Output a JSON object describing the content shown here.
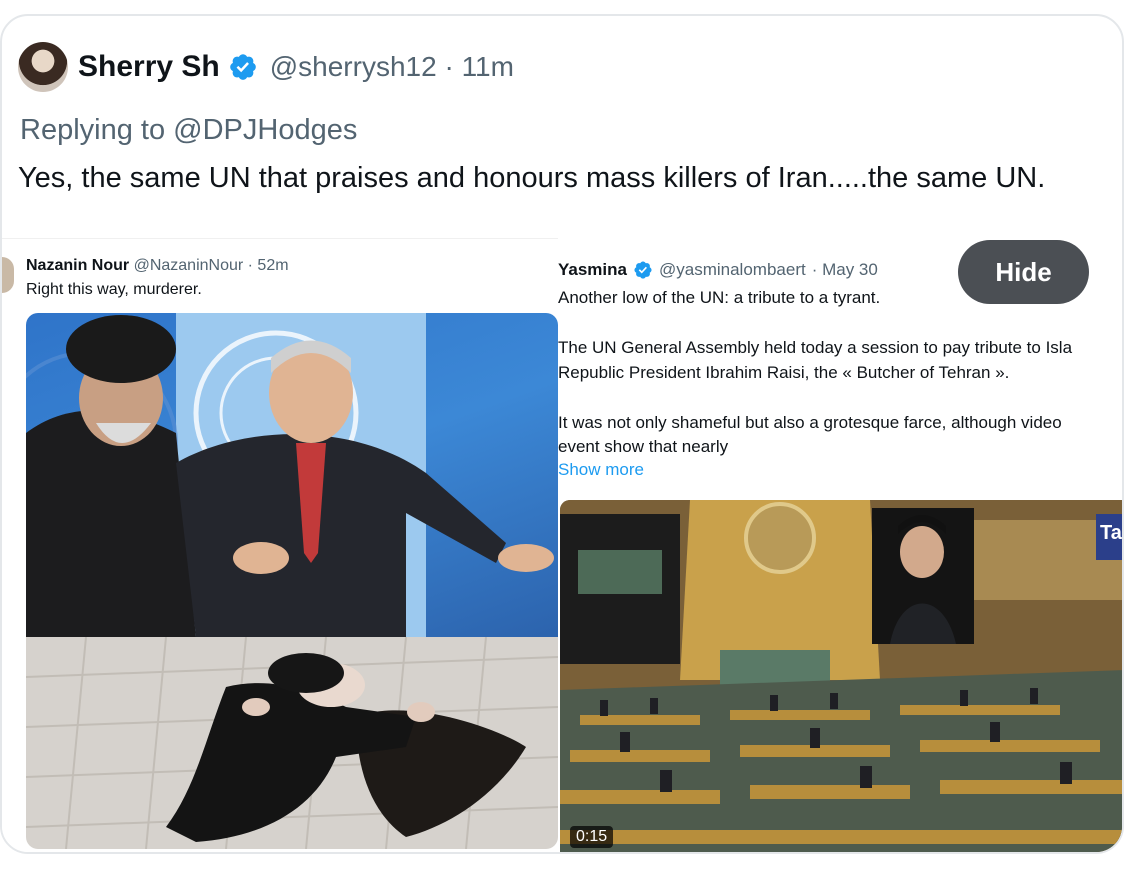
{
  "tweet": {
    "display_name": "Sherry Sh",
    "handle": "@sherrysh12",
    "separator": "·",
    "time": "11m",
    "verified": true,
    "replying_prefix": "Replying to",
    "replying_to": "@DPJHodges",
    "text": "Yes, the same UN that praises and honours mass killers of Iran.....the same UN."
  },
  "hide_button": {
    "label": "Hide"
  },
  "left_embed": {
    "name": "Nazanin Nour",
    "handle": "@NazaninNour",
    "time": "· 52m",
    "text": "Right this way, murderer."
  },
  "right_embed": {
    "name": "Yasmina",
    "handle": "@yasminalombaert",
    "time": "· May 30",
    "lines": [
      "Another low of the UN: a tribute to a tyrant.",
      "The UN General Assembly held today a session to pay tribute to Isla",
      "Republic President Ibrahim Raisi, the « Butcher of Tehran ».",
      "It was not only shameful but also a grotesque farce, although video",
      "event show that nearly"
    ],
    "show_more": "Show more",
    "video_duration": "0:15",
    "video_corner_label": "Ta"
  },
  "colors": {
    "verified_blue": "#1d9bf0",
    "text_primary": "#0f1419",
    "text_secondary": "#536471",
    "hide_button_bg": "#4b4f54"
  },
  "icons": {
    "verified": "verified-badge-icon"
  }
}
